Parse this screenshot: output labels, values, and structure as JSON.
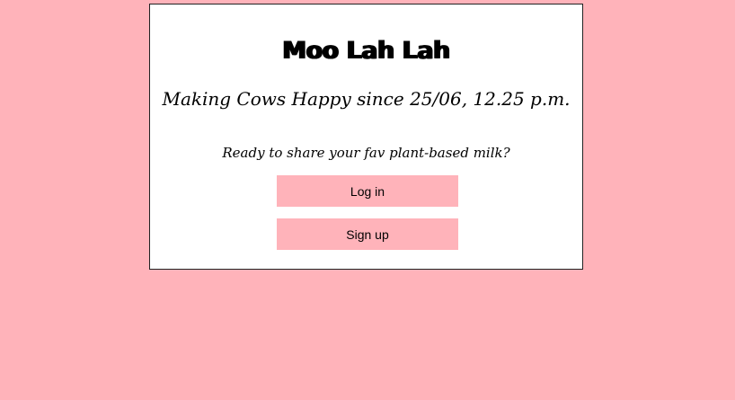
{
  "card": {
    "title": "Moo Lah Lah",
    "tagline": "Making Cows Happy since 25/06, 12.25 p.m.",
    "prompt": "Ready to share your fav plant-based milk?",
    "login_label": "Log in",
    "signup_label": "Sign up"
  },
  "colors": {
    "background": "#ffb3ba",
    "card": "#ffffff",
    "button": "#ffb3ba"
  }
}
